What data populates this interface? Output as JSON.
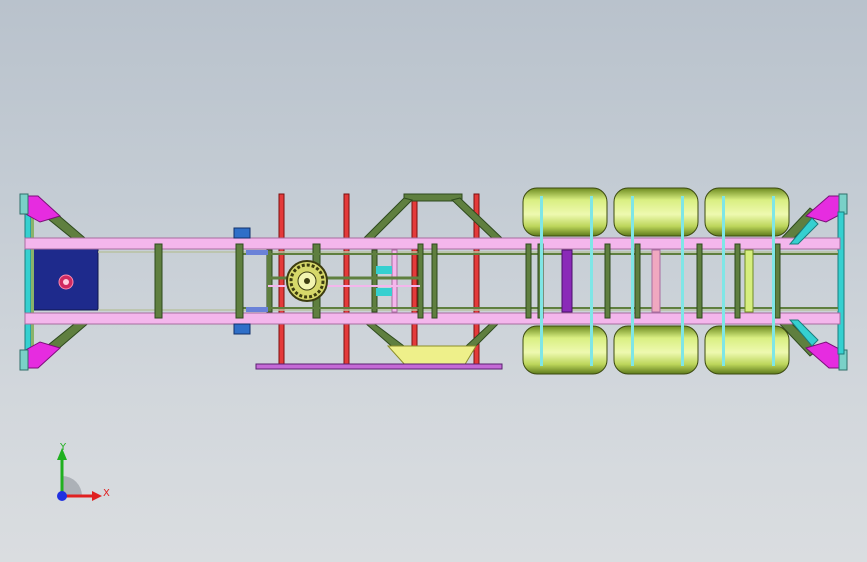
{
  "viewport": {
    "background_top": "#b9c2cc",
    "background_bottom": "#dadde0"
  },
  "model": {
    "kind": "trailer chassis, top view",
    "colors": {
      "main_beam": "#f4b6ec",
      "beam_edge": "#a86ca0",
      "crossmember": "#5f7f3f",
      "red_member": "#e43a3a",
      "gusset": "#e62ce0",
      "cyan": "#35d0d0",
      "kingpin_plate": "#1e2a8c",
      "wheel": "#d6ee7e",
      "wheel_dark": "#6f8a26",
      "tray": "#eef08a",
      "purple": "#8a2ab8"
    }
  },
  "triad": {
    "x_label": "X",
    "y_label": "Y",
    "x_color": "#e02020",
    "y_color": "#20b020",
    "z_color": "#2030e0"
  }
}
